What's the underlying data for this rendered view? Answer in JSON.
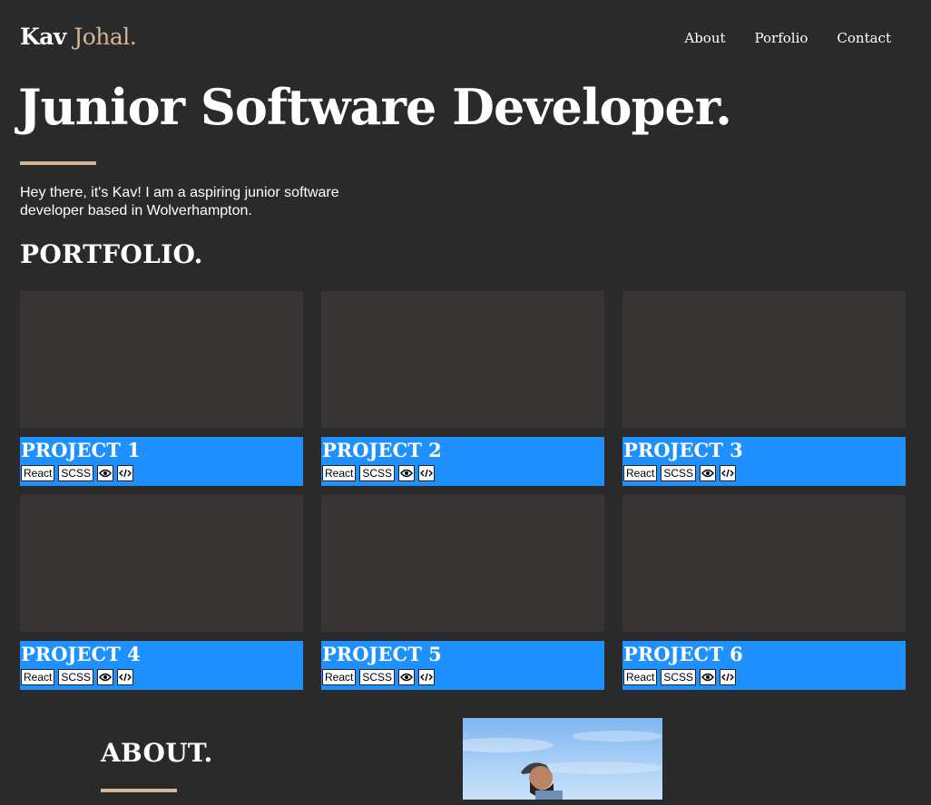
{
  "header": {
    "logo_first": "Kav",
    "logo_last": "Johal.",
    "nav": [
      {
        "label": "About"
      },
      {
        "label": "Porfolio"
      },
      {
        "label": "Contact"
      }
    ]
  },
  "hero": {
    "title": "Junior Software Developer.",
    "intro": "Hey there, it's Kav! I am a aspiring junior software developer based in Wolverhampton."
  },
  "portfolio": {
    "title": "PORTFOLIO.",
    "projects": [
      {
        "title": "PROJECT 1",
        "tags": [
          "React",
          "SCSS"
        ],
        "view_icon": "eye-icon",
        "code_icon": "code-icon"
      },
      {
        "title": "PROJECT 2",
        "tags": [
          "React",
          "SCSS"
        ],
        "view_icon": "eye-icon",
        "code_icon": "code-icon"
      },
      {
        "title": "PROJECT 3",
        "tags": [
          "React",
          "SCSS"
        ],
        "view_icon": "eye-icon",
        "code_icon": "code-icon"
      },
      {
        "title": "PROJECT 4",
        "tags": [
          "React",
          "SCSS"
        ],
        "view_icon": "eye-icon",
        "code_icon": "code-icon"
      },
      {
        "title": "PROJECT 5",
        "tags": [
          "React",
          "SCSS"
        ],
        "view_icon": "eye-icon",
        "code_icon": "code-icon"
      },
      {
        "title": "PROJECT 6",
        "tags": [
          "React",
          "SCSS"
        ],
        "view_icon": "eye-icon",
        "code_icon": "code-icon"
      }
    ]
  },
  "about": {
    "title": "ABOUT."
  },
  "colors": {
    "background": "#2b2a2b",
    "accent": "#d4b596",
    "project_band": "#1e90ff",
    "thumbnail": "#393434"
  }
}
